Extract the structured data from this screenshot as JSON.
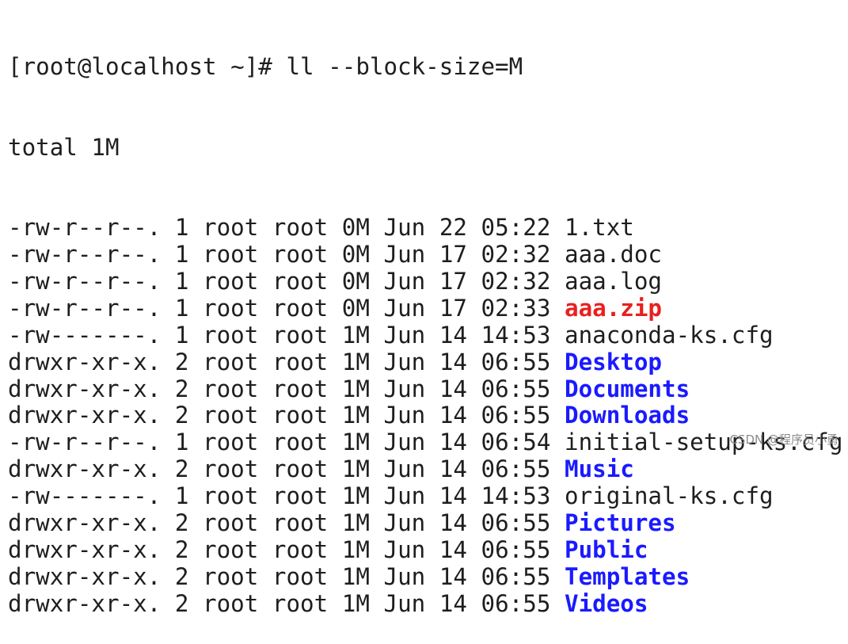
{
  "terminal": {
    "prompt": "[root@localhost ~]# ",
    "command": "ll --block-size=M",
    "total": "total 1M",
    "colors": {
      "directory": "#1a1aff",
      "archive": "#e8201f",
      "text": "#1e1e1e"
    },
    "entries": [
      {
        "perms": "-rw-r--r--.",
        "links": "1",
        "owner": "root",
        "group": "root",
        "size": "0M",
        "month": "Jun",
        "day": "22",
        "time": "05:22",
        "name": "1.txt",
        "type": "file"
      },
      {
        "perms": "-rw-r--r--.",
        "links": "1",
        "owner": "root",
        "group": "root",
        "size": "0M",
        "month": "Jun",
        "day": "17",
        "time": "02:32",
        "name": "aaa.doc",
        "type": "file"
      },
      {
        "perms": "-rw-r--r--.",
        "links": "1",
        "owner": "root",
        "group": "root",
        "size": "0M",
        "month": "Jun",
        "day": "17",
        "time": "02:32",
        "name": "aaa.log",
        "type": "file"
      },
      {
        "perms": "-rw-r--r--.",
        "links": "1",
        "owner": "root",
        "group": "root",
        "size": "0M",
        "month": "Jun",
        "day": "17",
        "time": "02:33",
        "name": "aaa.zip",
        "type": "archive"
      },
      {
        "perms": "-rw-------.",
        "links": "1",
        "owner": "root",
        "group": "root",
        "size": "1M",
        "month": "Jun",
        "day": "14",
        "time": "14:53",
        "name": "anaconda-ks.cfg",
        "type": "file"
      },
      {
        "perms": "drwxr-xr-x.",
        "links": "2",
        "owner": "root",
        "group": "root",
        "size": "1M",
        "month": "Jun",
        "day": "14",
        "time": "06:55",
        "name": "Desktop",
        "type": "dir"
      },
      {
        "perms": "drwxr-xr-x.",
        "links": "2",
        "owner": "root",
        "group": "root",
        "size": "1M",
        "month": "Jun",
        "day": "14",
        "time": "06:55",
        "name": "Documents",
        "type": "dir"
      },
      {
        "perms": "drwxr-xr-x.",
        "links": "2",
        "owner": "root",
        "group": "root",
        "size": "1M",
        "month": "Jun",
        "day": "14",
        "time": "06:55",
        "name": "Downloads",
        "type": "dir"
      },
      {
        "perms": "-rw-r--r--.",
        "links": "1",
        "owner": "root",
        "group": "root",
        "size": "1M",
        "month": "Jun",
        "day": "14",
        "time": "06:54",
        "name": "initial-setup-ks.cfg",
        "type": "file"
      },
      {
        "perms": "drwxr-xr-x.",
        "links": "2",
        "owner": "root",
        "group": "root",
        "size": "1M",
        "month": "Jun",
        "day": "14",
        "time": "06:55",
        "name": "Music",
        "type": "dir"
      },
      {
        "perms": "-rw-------.",
        "links": "1",
        "owner": "root",
        "group": "root",
        "size": "1M",
        "month": "Jun",
        "day": "14",
        "time": "14:53",
        "name": "original-ks.cfg",
        "type": "file"
      },
      {
        "perms": "drwxr-xr-x.",
        "links": "2",
        "owner": "root",
        "group": "root",
        "size": "1M",
        "month": "Jun",
        "day": "14",
        "time": "06:55",
        "name": "Pictures",
        "type": "dir"
      },
      {
        "perms": "drwxr-xr-x.",
        "links": "2",
        "owner": "root",
        "group": "root",
        "size": "1M",
        "month": "Jun",
        "day": "14",
        "time": "06:55",
        "name": "Public",
        "type": "dir"
      },
      {
        "perms": "drwxr-xr-x.",
        "links": "2",
        "owner": "root",
        "group": "root",
        "size": "1M",
        "month": "Jun",
        "day": "14",
        "time": "06:55",
        "name": "Templates",
        "type": "dir"
      },
      {
        "perms": "drwxr-xr-x.",
        "links": "2",
        "owner": "root",
        "group": "root",
        "size": "1M",
        "month": "Jun",
        "day": "14",
        "time": "06:55",
        "name": "Videos",
        "type": "dir"
      }
    ]
  },
  "watermark": "CSDN @程序员小勇"
}
